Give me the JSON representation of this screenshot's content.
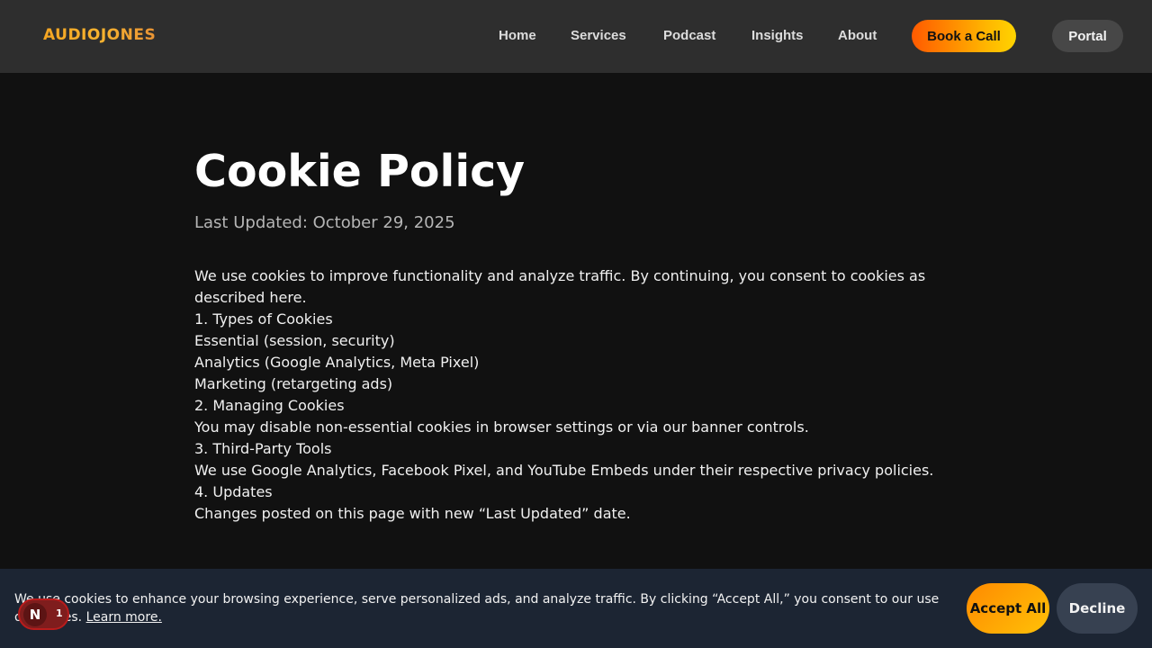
{
  "nav": {
    "logo": "AUDIOJONES",
    "links": [
      "Home",
      "Services",
      "Podcast",
      "Insights",
      "About"
    ],
    "book_call": "Book a Call",
    "portal": "Portal"
  },
  "page": {
    "title": "Cookie Policy",
    "updated": "Last Updated: October 29, 2025",
    "lines": [
      "We use cookies to improve functionality and analyze traffic. By continuing, you consent to cookies as described here.",
      "1. Types of Cookies",
      "Essential (session, security)",
      "Analytics (Google Analytics, Meta Pixel)",
      "Marketing (retargeting ads)",
      "2. Managing Cookies",
      "You may disable non-essential cookies in browser settings or via our banner controls.",
      "3. Third-Party Tools",
      "We use Google Analytics, Facebook Pixel, and YouTube Embeds under their respective privacy policies.",
      "4. Updates",
      "Changes posted on this page with new “Last Updated” date."
    ]
  },
  "cookie_banner": {
    "text": "We use cookies to enhance your browsing experience, serve personalized ads, and analyze traffic. By clicking “Accept All,” you consent to our use of cookies.",
    "learn_more": "Learn more.",
    "accept": "Accept All",
    "decline": "Decline"
  },
  "notification_badge": {
    "letter": "N",
    "count": "1"
  },
  "colors": {
    "accent_orange": "#ff8a00",
    "accent_yellow": "#ffc107",
    "nav_bg": "#2e2e2e",
    "page_bg": "#111111",
    "banner_bg": "#1c2533"
  }
}
